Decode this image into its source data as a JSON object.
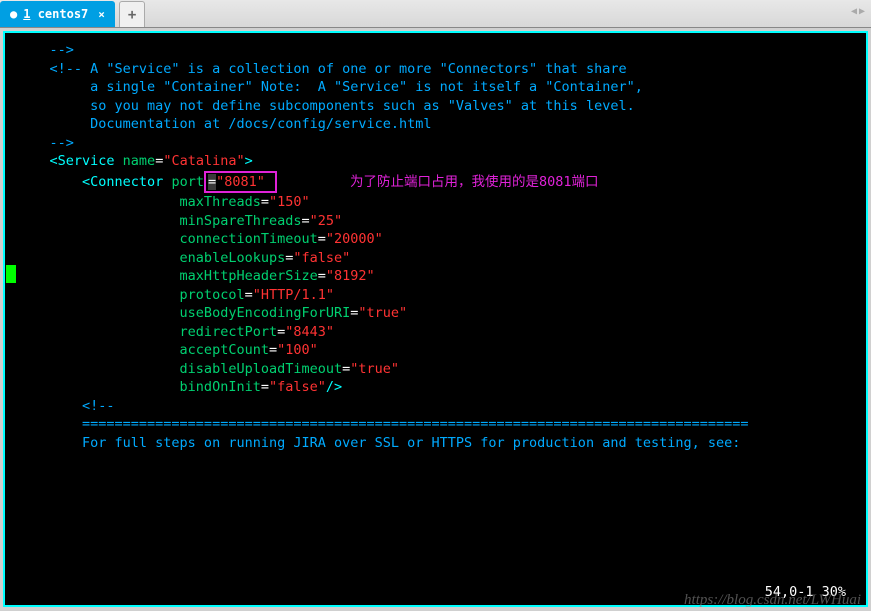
{
  "tab": {
    "num": "1",
    "title": "centos7",
    "close": "×",
    "add": "+"
  },
  "nav": {
    "left": "◀",
    "right": "▶"
  },
  "annotation": "为了防止端口占用，我使用的是8081端口",
  "code": {
    "l1": "    -->",
    "l2": "",
    "l3a": "    <!-- A \"Service\" is a collection of one or more \"Connectors\" that share",
    "l4a": "         a single \"Container\" Note:  A \"Service\" is not itself a \"Container\",",
    "l5a": "         so you may not define subcomponents such as \"Valves\" at this level.",
    "l6a": "         Documentation at /docs/config/service.html",
    "l7": "    -->",
    "l8_open": "    <",
    "l8_tag": "Service ",
    "l8_attr": "name",
    "l8_eq": "=",
    "l8_val": "\"Catalina\"",
    "l8_close": ">",
    "l9": "",
    "l10_open": "        <",
    "l10_tag": "Connector ",
    "l10_attr": "port",
    "l10_eq": "=",
    "l10_val": "\"8081\"",
    "l11": "",
    "l12_attr": "                    maxThreads",
    "l12_eq": "=",
    "l12_val": "\"150\"",
    "l13_attr": "                    minSpareThreads",
    "l13_eq": "=",
    "l13_val": "\"25\"",
    "l14_attr": "                    connectionTimeout",
    "l14_eq": "=",
    "l14_val": "\"20000\"",
    "l15": "",
    "l16_attr": "                    enableLookups",
    "l16_eq": "=",
    "l16_val": "\"false\"",
    "l17_attr": "                    maxHttpHeaderSize",
    "l17_eq": "=",
    "l17_val": "\"8192\"",
    "l18_attr": "                    protocol",
    "l18_eq": "=",
    "l18_val": "\"HTTP/1.1\"",
    "l19_attr": "                    useBodyEncodingForURI",
    "l19_eq": "=",
    "l19_val": "\"true\"",
    "l20_attr": "                    redirectPort",
    "l20_eq": "=",
    "l20_val": "\"8443\"",
    "l21_attr": "                    acceptCount",
    "l21_eq": "=",
    "l21_val": "\"100\"",
    "l22_attr": "                    disableUploadTimeout",
    "l22_eq": "=",
    "l22_val": "\"true\"",
    "l23_attr": "                    bindOnInit",
    "l23_eq": "=",
    "l23_val": "\"false\"",
    "l23_close": "/>",
    "l24": "",
    "l25": "        <!--",
    "l26": "        ==================================================================================",
    "l27": "",
    "l28": "        For full steps on running JIRA over SSL or HTTPS for production and testing, see:"
  },
  "status": "54,0-1        30%",
  "watermark": "https://blog.csdn.net/LWHuai"
}
